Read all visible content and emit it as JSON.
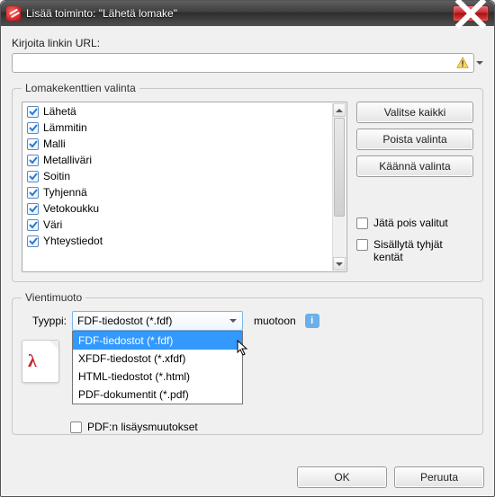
{
  "window": {
    "title": "Lisää toiminto: \"Lähetä lomake\""
  },
  "url_section": {
    "label": "Kirjoita linkin URL:",
    "value": ""
  },
  "form_fields": {
    "legend": "Lomakekenttien valinta",
    "items": [
      {
        "label": "Lähetä",
        "checked": true
      },
      {
        "label": "Lämmitin",
        "checked": true
      },
      {
        "label": "Malli",
        "checked": true
      },
      {
        "label": "Metalliväri",
        "checked": true
      },
      {
        "label": "Soitin",
        "checked": true
      },
      {
        "label": "Tyhjennä",
        "checked": true
      },
      {
        "label": "Vetokoukku",
        "checked": true
      },
      {
        "label": "Väri",
        "checked": true
      },
      {
        "label": "Yhteystiedot",
        "checked": true
      }
    ],
    "buttons": {
      "select_all": "Valitse kaikki",
      "deselect": "Poista valinta",
      "invert": "Käännä valinta"
    },
    "options": {
      "exclude": "Jätä pois valitut",
      "include_empty": "Sisällytä tyhjät kentät"
    }
  },
  "export": {
    "legend": "Vientimuoto",
    "type_label": "Tyyppi:",
    "selected": "FDF-tiedostot (*.fdf)",
    "options": [
      "FDF-tiedostot (*.fdf)",
      "XFDF-tiedostot (*.xfdf)",
      "HTML-tiedostot (*.html)",
      "PDF-dokumentit (*.pdf)"
    ],
    "export_note_suffix": "muotoon",
    "pdf_changes": "PDF:n lisäysmuutokset"
  },
  "footer": {
    "ok": "OK",
    "cancel": "Peruuta"
  }
}
